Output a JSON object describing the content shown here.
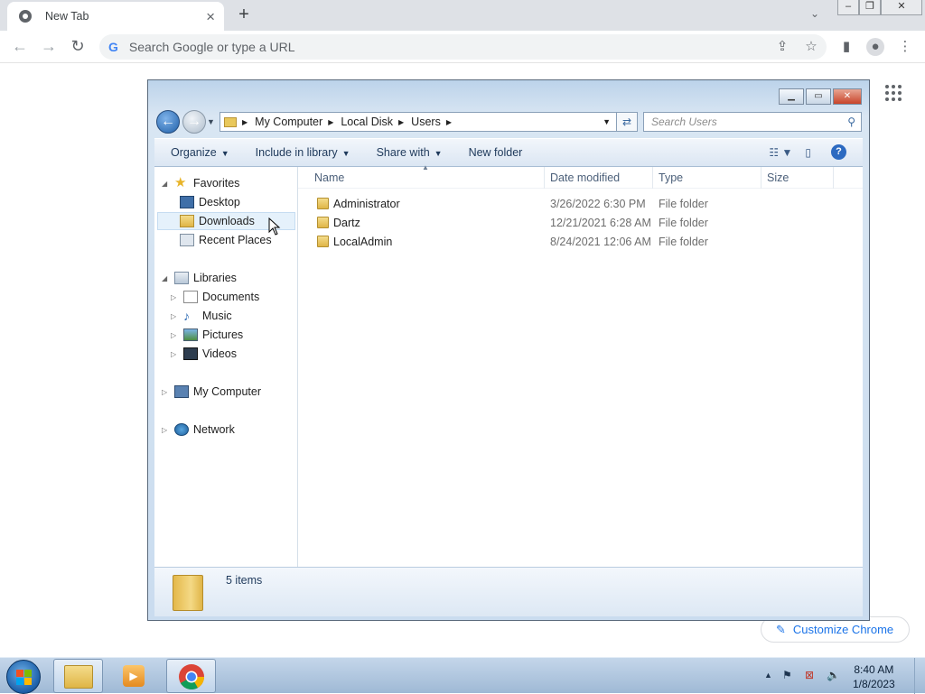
{
  "browser": {
    "tab_title": "New Tab",
    "omnibox_placeholder": "Search Google or type a URL",
    "customize_label": "Customize Chrome"
  },
  "explorer": {
    "breadcrumbs": [
      "My Computer",
      "Local Disk",
      "Users"
    ],
    "search_placeholder": "Search Users",
    "commands": {
      "organize": "Organize",
      "include": "Include in library",
      "share": "Share with",
      "new_folder": "New folder"
    },
    "nav": {
      "favorites": "Favorites",
      "desktop": "Desktop",
      "downloads": "Downloads",
      "recent": "Recent Places",
      "libraries": "Libraries",
      "documents": "Documents",
      "music": "Music",
      "pictures": "Pictures",
      "videos": "Videos",
      "computer": "My Computer",
      "network": "Network"
    },
    "columns": {
      "name": "Name",
      "date": "Date modified",
      "type": "Type",
      "size": "Size"
    },
    "files": [
      {
        "name": "Administrator",
        "date": "3/26/2022 6:30 PM",
        "type": "File folder"
      },
      {
        "name": "Dartz",
        "date": "12/21/2021 6:28 AM",
        "type": "File folder"
      },
      {
        "name": "LocalAdmin",
        "date": "8/24/2021 12:06 AM",
        "type": "File folder"
      }
    ],
    "item_count": "5 items"
  },
  "taskbar": {
    "time": "8:40 AM",
    "date": "1/8/2023"
  },
  "colors": {
    "chrome_blue": "#1a73e8",
    "explorer_frame": "#bcd3ea",
    "selection": "#e5f1fb"
  }
}
